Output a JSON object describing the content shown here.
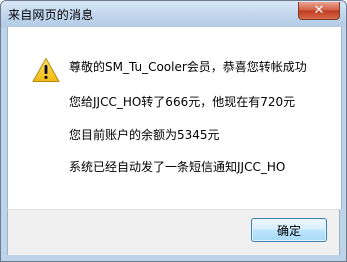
{
  "dialog": {
    "title": "来自网页的消息",
    "close_symbol": "✕",
    "icon": "warning-icon",
    "messages": [
      "尊敬的SM_Tu_Cooler会员，恭喜您转帐成功",
      "您给JJCC_HO转了666元，他现在有720元",
      "您目前账户的余额为5345元",
      "系统已经自动发了一条短信通知JJCC_HO"
    ],
    "ok_label": "确定"
  },
  "colors": {
    "frame": "#bdd3ea",
    "close_button": "#c9452a",
    "warning_fill": "#f3c417",
    "ok_border": "#3c7fb1"
  }
}
